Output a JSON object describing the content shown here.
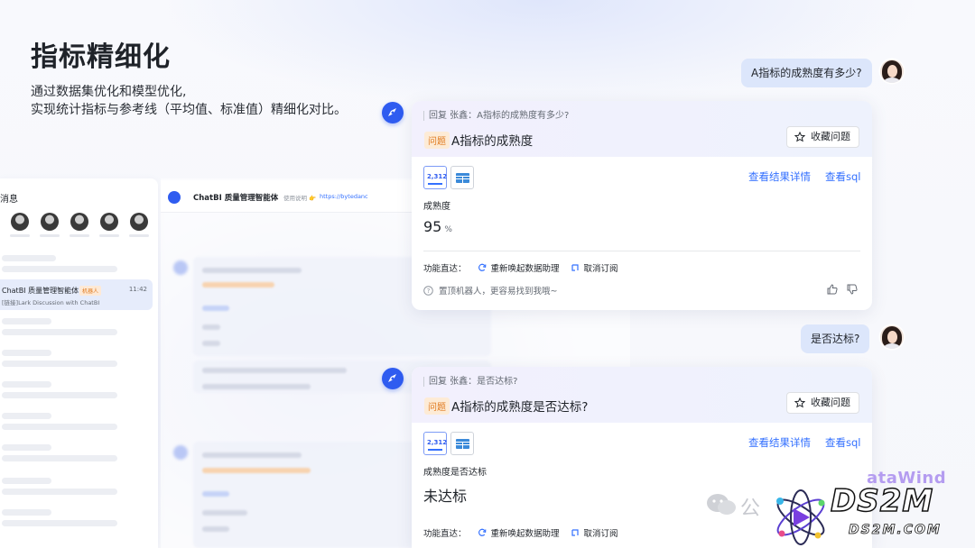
{
  "slide": {
    "title": "指标精细化",
    "subtitle_line1": "通过数据集优化和模型优化,",
    "subtitle_line2": "实现统计指标与参考线（平均值、标准值）精细化对比。"
  },
  "background_app": {
    "sidebar_header": "消息",
    "chat_item": {
      "name": "ChatBI 质量管理智能体",
      "tag": "机器人",
      "time": "11:42",
      "message": "[链接]Lark Discussion with ChatBI"
    },
    "header": {
      "name": "ChatBI 质量管理智能体",
      "usage": "使用说明 👉",
      "url": "https://bytedanc"
    }
  },
  "chat": {
    "messages": [
      {
        "user_question": "A指标的成熟度有多少?",
        "reply_prefix": "回复 张鑫：A指标的成熟度有多少?",
        "badge": "问题",
        "question_title": "A指标的成熟度",
        "favorite_label": "收藏问题",
        "icon_number": "2,312",
        "link_details": "查看结果详情",
        "link_sql": "查看sql",
        "metric_label": "成熟度",
        "metric_value": "95",
        "metric_unit": "%",
        "functions_label": "功能直达：",
        "function_rewake": "重新唤起数据助理",
        "function_unsub": "取消订阅",
        "tip": "置顶机器人，更容易找到我哦~"
      },
      {
        "user_question": "是否达标?",
        "reply_prefix": "回复 张鑫：是否达标?",
        "badge": "问题",
        "question_title": "A指标的成熟度是否达标?",
        "favorite_label": "收藏问题",
        "icon_number": "2,312",
        "link_details": "查看结果详情",
        "link_sql": "查看sql",
        "metric_label": "成熟度是否达标",
        "metric_value": "未达标",
        "functions_label": "功能直达：",
        "function_rewake": "重新唤起数据助理",
        "function_unsub": "取消订阅"
      }
    ]
  },
  "watermark": {
    "wechat_text": "公",
    "brand_partial": "ataWind",
    "ds2m_big": "DS2M",
    "ds2m_small": "DS2M.COM"
  },
  "colors": {
    "accent_blue": "#3370ff",
    "badge_orange": "#e07a1f",
    "user_bubble": "#dce6fb",
    "bot_avatar": "#2f5cf0"
  }
}
